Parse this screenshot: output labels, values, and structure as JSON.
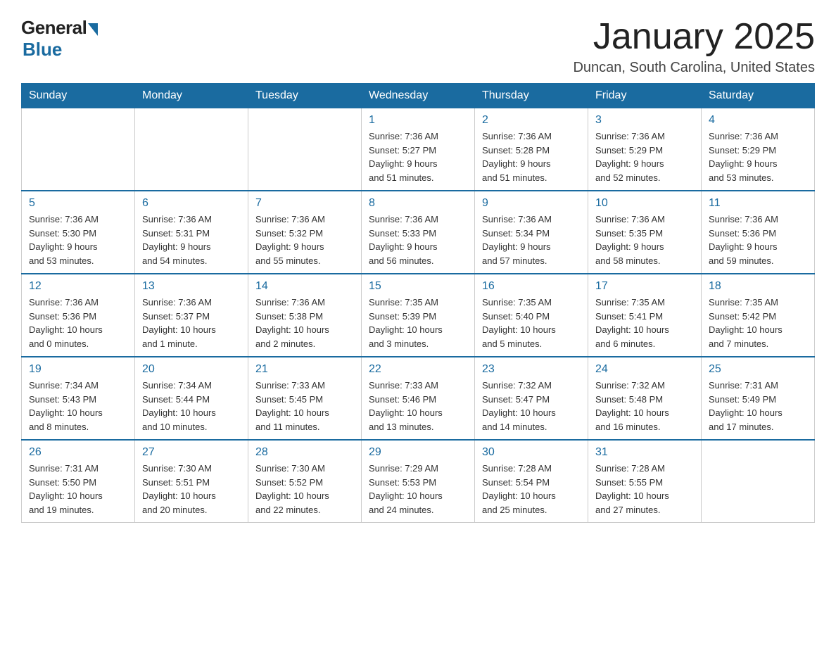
{
  "logo": {
    "general": "General",
    "blue": "Blue"
  },
  "title": "January 2025",
  "location": "Duncan, South Carolina, United States",
  "days_of_week": [
    "Sunday",
    "Monday",
    "Tuesday",
    "Wednesday",
    "Thursday",
    "Friday",
    "Saturday"
  ],
  "weeks": [
    [
      {
        "day": "",
        "info": ""
      },
      {
        "day": "",
        "info": ""
      },
      {
        "day": "",
        "info": ""
      },
      {
        "day": "1",
        "info": "Sunrise: 7:36 AM\nSunset: 5:27 PM\nDaylight: 9 hours\nand 51 minutes."
      },
      {
        "day": "2",
        "info": "Sunrise: 7:36 AM\nSunset: 5:28 PM\nDaylight: 9 hours\nand 51 minutes."
      },
      {
        "day": "3",
        "info": "Sunrise: 7:36 AM\nSunset: 5:29 PM\nDaylight: 9 hours\nand 52 minutes."
      },
      {
        "day": "4",
        "info": "Sunrise: 7:36 AM\nSunset: 5:29 PM\nDaylight: 9 hours\nand 53 minutes."
      }
    ],
    [
      {
        "day": "5",
        "info": "Sunrise: 7:36 AM\nSunset: 5:30 PM\nDaylight: 9 hours\nand 53 minutes."
      },
      {
        "day": "6",
        "info": "Sunrise: 7:36 AM\nSunset: 5:31 PM\nDaylight: 9 hours\nand 54 minutes."
      },
      {
        "day": "7",
        "info": "Sunrise: 7:36 AM\nSunset: 5:32 PM\nDaylight: 9 hours\nand 55 minutes."
      },
      {
        "day": "8",
        "info": "Sunrise: 7:36 AM\nSunset: 5:33 PM\nDaylight: 9 hours\nand 56 minutes."
      },
      {
        "day": "9",
        "info": "Sunrise: 7:36 AM\nSunset: 5:34 PM\nDaylight: 9 hours\nand 57 minutes."
      },
      {
        "day": "10",
        "info": "Sunrise: 7:36 AM\nSunset: 5:35 PM\nDaylight: 9 hours\nand 58 minutes."
      },
      {
        "day": "11",
        "info": "Sunrise: 7:36 AM\nSunset: 5:36 PM\nDaylight: 9 hours\nand 59 minutes."
      }
    ],
    [
      {
        "day": "12",
        "info": "Sunrise: 7:36 AM\nSunset: 5:36 PM\nDaylight: 10 hours\nand 0 minutes."
      },
      {
        "day": "13",
        "info": "Sunrise: 7:36 AM\nSunset: 5:37 PM\nDaylight: 10 hours\nand 1 minute."
      },
      {
        "day": "14",
        "info": "Sunrise: 7:36 AM\nSunset: 5:38 PM\nDaylight: 10 hours\nand 2 minutes."
      },
      {
        "day": "15",
        "info": "Sunrise: 7:35 AM\nSunset: 5:39 PM\nDaylight: 10 hours\nand 3 minutes."
      },
      {
        "day": "16",
        "info": "Sunrise: 7:35 AM\nSunset: 5:40 PM\nDaylight: 10 hours\nand 5 minutes."
      },
      {
        "day": "17",
        "info": "Sunrise: 7:35 AM\nSunset: 5:41 PM\nDaylight: 10 hours\nand 6 minutes."
      },
      {
        "day": "18",
        "info": "Sunrise: 7:35 AM\nSunset: 5:42 PM\nDaylight: 10 hours\nand 7 minutes."
      }
    ],
    [
      {
        "day": "19",
        "info": "Sunrise: 7:34 AM\nSunset: 5:43 PM\nDaylight: 10 hours\nand 8 minutes."
      },
      {
        "day": "20",
        "info": "Sunrise: 7:34 AM\nSunset: 5:44 PM\nDaylight: 10 hours\nand 10 minutes."
      },
      {
        "day": "21",
        "info": "Sunrise: 7:33 AM\nSunset: 5:45 PM\nDaylight: 10 hours\nand 11 minutes."
      },
      {
        "day": "22",
        "info": "Sunrise: 7:33 AM\nSunset: 5:46 PM\nDaylight: 10 hours\nand 13 minutes."
      },
      {
        "day": "23",
        "info": "Sunrise: 7:32 AM\nSunset: 5:47 PM\nDaylight: 10 hours\nand 14 minutes."
      },
      {
        "day": "24",
        "info": "Sunrise: 7:32 AM\nSunset: 5:48 PM\nDaylight: 10 hours\nand 16 minutes."
      },
      {
        "day": "25",
        "info": "Sunrise: 7:31 AM\nSunset: 5:49 PM\nDaylight: 10 hours\nand 17 minutes."
      }
    ],
    [
      {
        "day": "26",
        "info": "Sunrise: 7:31 AM\nSunset: 5:50 PM\nDaylight: 10 hours\nand 19 minutes."
      },
      {
        "day": "27",
        "info": "Sunrise: 7:30 AM\nSunset: 5:51 PM\nDaylight: 10 hours\nand 20 minutes."
      },
      {
        "day": "28",
        "info": "Sunrise: 7:30 AM\nSunset: 5:52 PM\nDaylight: 10 hours\nand 22 minutes."
      },
      {
        "day": "29",
        "info": "Sunrise: 7:29 AM\nSunset: 5:53 PM\nDaylight: 10 hours\nand 24 minutes."
      },
      {
        "day": "30",
        "info": "Sunrise: 7:28 AM\nSunset: 5:54 PM\nDaylight: 10 hours\nand 25 minutes."
      },
      {
        "day": "31",
        "info": "Sunrise: 7:28 AM\nSunset: 5:55 PM\nDaylight: 10 hours\nand 27 minutes."
      },
      {
        "day": "",
        "info": ""
      }
    ]
  ]
}
